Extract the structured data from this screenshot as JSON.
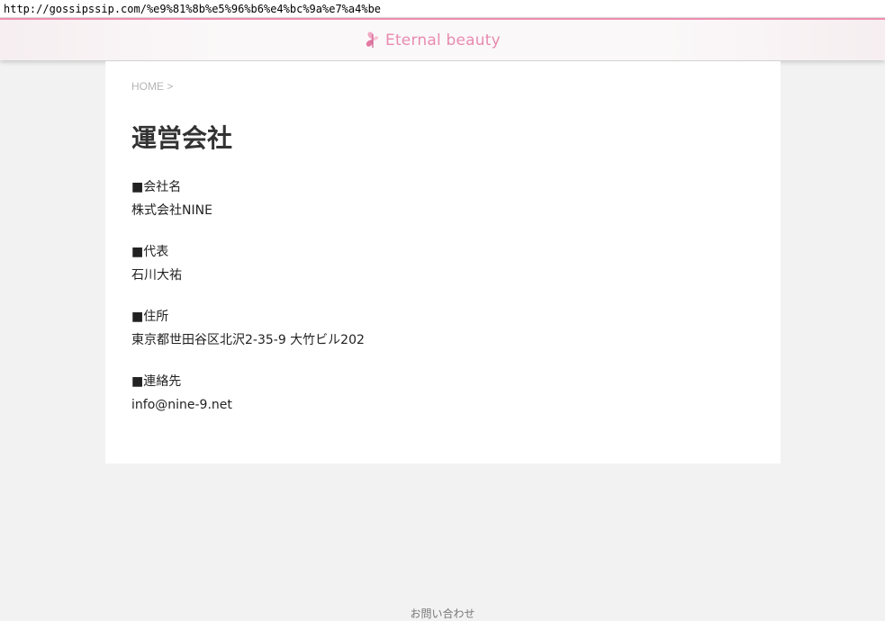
{
  "browser": {
    "url": "http://gossipssip.com/%e9%81%8b%e5%96%b6%e4%bc%9a%e7%a4%be"
  },
  "header": {
    "logo_text": "Eternal beauty",
    "logo_icon": "butterfly-icon",
    "accent_color": "#e88bb0"
  },
  "breadcrumb": {
    "home_label": "HOME",
    "separator": ">"
  },
  "page": {
    "title": "運営会社",
    "sections": [
      {
        "label": "■会社名",
        "value": "株式会社NINE"
      },
      {
        "label": "■代表",
        "value": "石川大祐"
      },
      {
        "label": "■住所",
        "value": "東京都世田谷区北沢2-35-9 大竹ビル202"
      },
      {
        "label": "■連絡先",
        "value": "info@nine-9.net"
      }
    ]
  },
  "footer": {
    "contact_label": "お問い合わせ"
  }
}
